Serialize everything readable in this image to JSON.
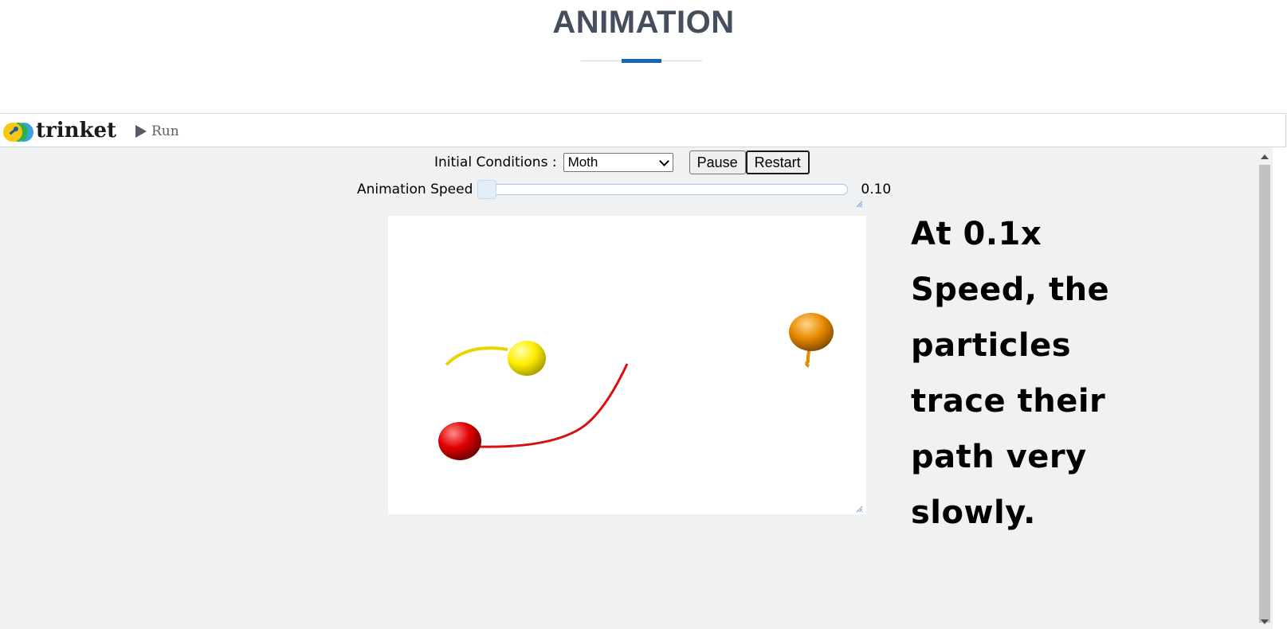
{
  "page": {
    "title": "ANIMATION",
    "accent_color": "#1665b4"
  },
  "toolbar": {
    "logo_text": "trinket",
    "run_label": "Run",
    "run_icon": "play-icon"
  },
  "controls": {
    "initial_conditions_label": "Initial Conditions :",
    "initial_conditions_value": "Moth",
    "pause_label": "Pause",
    "restart_label": "Restart",
    "speed_label": "Animation Speed",
    "speed_value": "0.10",
    "speed_fraction": 0.0
  },
  "scene": {
    "particles": [
      {
        "name": "yellow-particle",
        "color": "#ffee00"
      },
      {
        "name": "red-particle",
        "color": "#e00000"
      },
      {
        "name": "orange-particle",
        "color": "#e88a00"
      }
    ]
  },
  "caption": {
    "lines": [
      "At 0.1x",
      "Speed, the",
      "particles",
      "trace their",
      "path very",
      "slowly."
    ]
  }
}
